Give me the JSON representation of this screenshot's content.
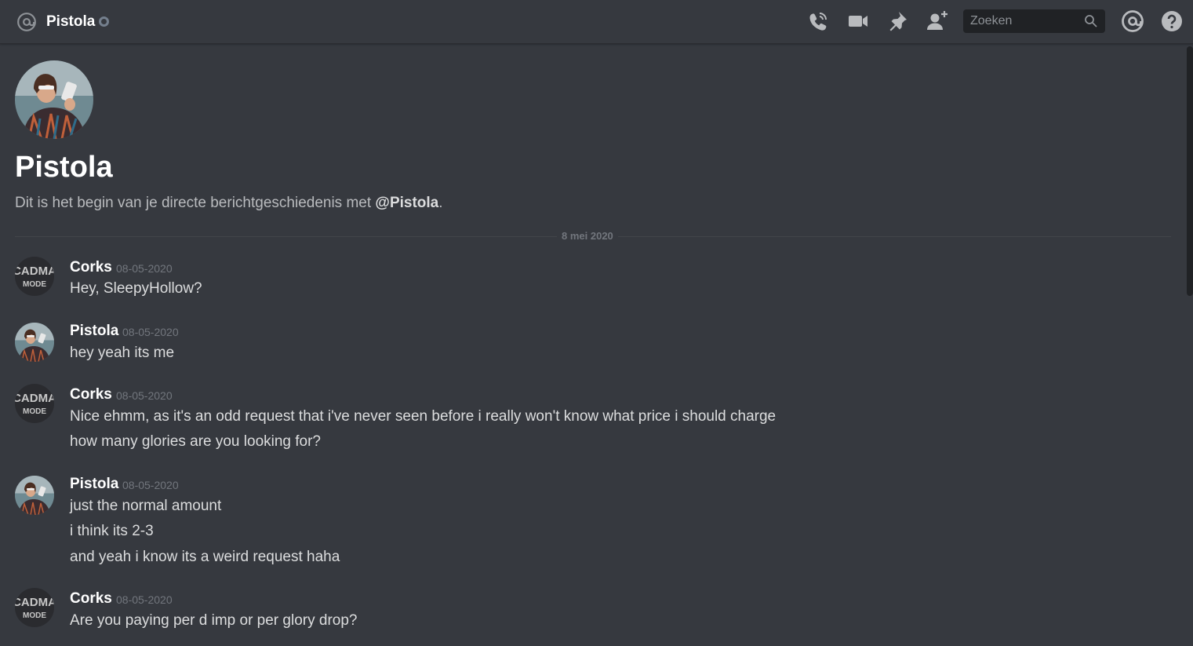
{
  "header": {
    "channel_name": "Pistola",
    "at_icon": "at-sign-icon",
    "status_icon": "offline-status-icon",
    "icons": {
      "call": "voice-call-icon",
      "video": "video-call-icon",
      "pin": "pinned-messages-icon",
      "add_friend": "add-friend-icon",
      "mentions": "mentions-icon",
      "help": "help-icon"
    },
    "search": {
      "placeholder": "Zoeken",
      "icon": "search-icon"
    }
  },
  "intro": {
    "name": "Pistola",
    "desc_prefix": "Dit is het begin van je directe berichtgeschiedenis met ",
    "desc_mention": "@Pistola",
    "desc_suffix": "."
  },
  "date_divider": "8 mei 2020",
  "messages": [
    {
      "author": "Corks",
      "timestamp": "08-05-2020",
      "lines": [
        "Hey, SleepyHollow?"
      ]
    },
    {
      "author": "Pistola",
      "timestamp": "08-05-2020",
      "lines": [
        "hey yeah its me"
      ]
    },
    {
      "author": "Corks",
      "timestamp": "08-05-2020",
      "lines": [
        "Nice ehmm, as it's an odd request that i've never seen before i really won't know what price i should charge",
        "how many glories are you looking for?"
      ]
    },
    {
      "author": "Pistola",
      "timestamp": "08-05-2020",
      "lines": [
        "just the normal amount",
        "i think its 2-3",
        "and yeah i know its a weird request haha"
      ]
    },
    {
      "author": "Corks",
      "timestamp": "08-05-2020",
      "lines": [
        "Are you paying per d imp or per glory drop?"
      ]
    }
  ],
  "avatar_logo_text": {
    "line1": "CADMA",
    "line2": "MODE"
  },
  "colors": {
    "background": "#36393f",
    "header_text": "#ffffff",
    "message_text": "#dcddde",
    "muted_text": "#72767d",
    "search_bg": "#202225",
    "status_offline": "#747f8d"
  }
}
